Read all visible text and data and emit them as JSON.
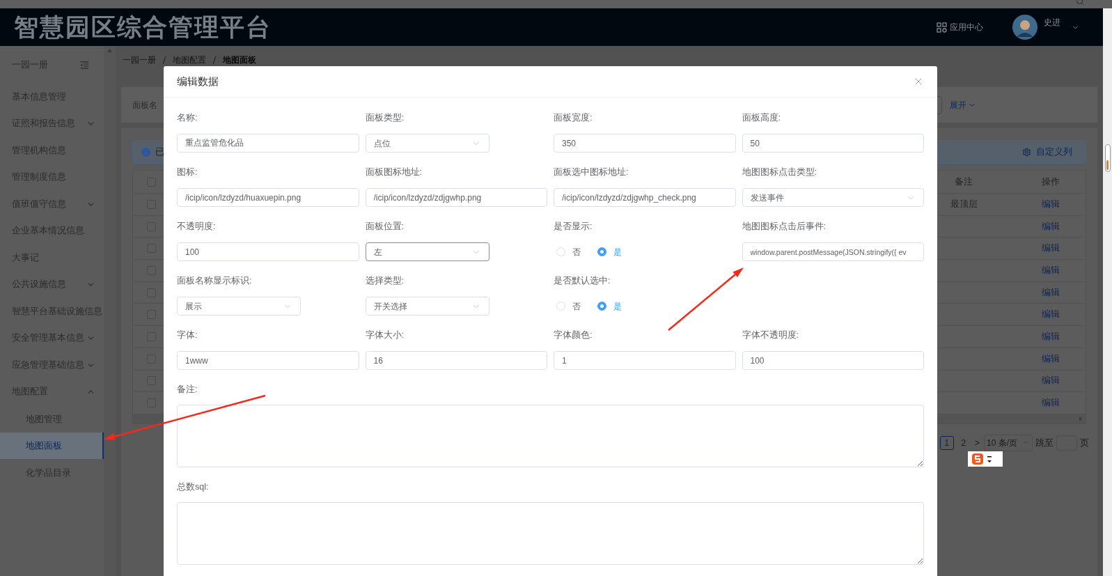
{
  "header": {
    "title": "智慧园区综合管理平台",
    "app_center": "应用中心",
    "user": "史进"
  },
  "sidebar": {
    "title": "一园一册",
    "items": [
      {
        "label": "基本信息管理",
        "kind": "link"
      },
      {
        "label": "证照和报告信息",
        "kind": "group",
        "expanded": false
      },
      {
        "label": "管理机构信息",
        "kind": "link"
      },
      {
        "label": "管理制度信息",
        "kind": "link"
      },
      {
        "label": "值班值守信息",
        "kind": "group",
        "expanded": false
      },
      {
        "label": "企业基本情况信息",
        "kind": "link"
      },
      {
        "label": "大事记",
        "kind": "link"
      },
      {
        "label": "公共设施信息",
        "kind": "group",
        "expanded": false
      },
      {
        "label": "智慧平台基础设施信息",
        "kind": "link"
      },
      {
        "label": "安全管理基本信息",
        "kind": "group",
        "expanded": false
      },
      {
        "label": "应急管理基础信息",
        "kind": "group",
        "expanded": false
      },
      {
        "label": "地图配置",
        "kind": "group",
        "expanded": true,
        "children": [
          {
            "label": "地图管理",
            "selected": false
          },
          {
            "label": "地图面板",
            "selected": true
          },
          {
            "label": "化学品目录",
            "selected": false
          }
        ]
      }
    ]
  },
  "breadcrumb": [
    "一园一册",
    "地图配置",
    "地图面板"
  ],
  "search": {
    "label": "面板名",
    "toggle": "展开"
  },
  "alert": {
    "text": "已",
    "action": "自定义列"
  },
  "table": {
    "columns": [
      "备注",
      "操作"
    ],
    "header_checked": false,
    "rows": [
      {
        "checked": false,
        "note": "最顶层",
        "action": "编辑"
      },
      {
        "checked": false,
        "action": "编辑"
      },
      {
        "checked": false,
        "action": "编辑"
      },
      {
        "checked": false,
        "action": "编辑"
      },
      {
        "checked": false,
        "action": "编辑"
      },
      {
        "checked": false,
        "action": "编辑"
      },
      {
        "checked": false,
        "action": "编辑"
      },
      {
        "checked": false,
        "action": "编辑"
      },
      {
        "checked": false,
        "action": "编辑"
      },
      {
        "checked": false,
        "action": "编辑"
      }
    ]
  },
  "pagination": {
    "pages": [
      {
        "label": "1",
        "selected": true
      },
      {
        "label": "2",
        "selected": false
      }
    ],
    "next": ">",
    "page_size": "10 条/页",
    "jump_label": "跳至",
    "page_suffix": "页"
  },
  "dialog": {
    "title": "编辑数据",
    "rows": [
      [
        {
          "label": "名称:",
          "kind": "text",
          "value": "重点监管危化品"
        },
        {
          "label": "面板类型:",
          "kind": "select",
          "value": "点位",
          "full_width": false,
          "focused": false
        },
        {
          "label": "面板宽度:",
          "kind": "text",
          "value": "350"
        },
        {
          "label": "面板高度:",
          "kind": "text",
          "value": "50"
        }
      ],
      [
        {
          "label": "图标:",
          "kind": "text",
          "value": "/icip/icon/lzdyzd/huaxuepin.png"
        },
        {
          "label": "面板图标地址:",
          "kind": "text",
          "value": "/icip/icon/lzdyzd/zdjgwhp.png"
        },
        {
          "label": "面板选中图标地址:",
          "kind": "text",
          "value": "/icip/icon/lzdyzd/zdjgwhp_check.png"
        },
        {
          "label": "地图图标点击类型:",
          "kind": "select",
          "value": "发送事件",
          "full_width": true,
          "focused": false
        }
      ],
      [
        {
          "label": "不透明度:",
          "kind": "text",
          "value": "100"
        },
        {
          "label": "面板位置:",
          "kind": "select",
          "value": "左",
          "full_width": false,
          "focused": true
        },
        {
          "label": "是否显示:",
          "kind": "radio",
          "options": [
            {
              "label": "否",
              "selected": false
            },
            {
              "label": "是",
              "selected": true
            }
          ]
        },
        {
          "label": "地图图标点击后事件:",
          "kind": "text",
          "value": "window.parent.postMessage(JSON.stringify({ ev"
        }
      ],
      [
        {
          "label": "面板名称显示标识:",
          "kind": "select",
          "value": "展示",
          "full_width": false,
          "focused": false
        },
        {
          "label": "选择类型:",
          "kind": "select",
          "value": "开关选择",
          "full_width": false,
          "focused": false
        },
        {
          "label": "是否默认选中:",
          "kind": "radio",
          "options": [
            {
              "label": "否",
              "selected": false
            },
            {
              "label": "是",
              "selected": true
            }
          ]
        }
      ],
      [
        {
          "label": "字体:",
          "kind": "text",
          "value": "1www"
        },
        {
          "label": "字体大小:",
          "kind": "text",
          "value": "16"
        },
        {
          "label": "字体颜色:",
          "kind": "text",
          "value": "1"
        },
        {
          "label": "字体不透明度:",
          "kind": "text",
          "value": "100"
        }
      ]
    ],
    "textareas": [
      {
        "label": "备注:"
      },
      {
        "label": "总数sql:"
      }
    ]
  }
}
